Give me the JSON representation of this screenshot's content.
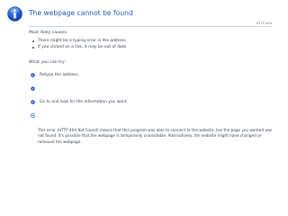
{
  "error_page": {
    "title": "The webpage cannot be found",
    "http_code": "HTTP 404",
    "causes_heading": "Most likely causes:",
    "causes": [
      "There might be a typing error in the address.",
      "If you clicked on a link, it may be out of date."
    ],
    "actions_heading": "What you can try:",
    "actions": [
      {
        "label": "Retype the address.",
        "icon": "blue-arrow-bullet-icon"
      },
      {
        "label": "",
        "icon": "blue-arrow-bullet-icon"
      },
      {
        "label": "Go to  and look for the information you want.",
        "icon": "blue-arrow-bullet-icon"
      },
      {
        "label": "",
        "icon": "expand-arrow-icon"
      }
    ],
    "details": "This error (HTTP 404 Not Found) means that this program was able to connect to the website, but the page you wanted was not found. It's possible that the webpage is temporarily unavailable. Alternatively, the website might have changed or removed the webpage.",
    "colors": {
      "title": "#1f5fae",
      "icon": "#1b5ed4",
      "text": "#3a4457"
    }
  }
}
